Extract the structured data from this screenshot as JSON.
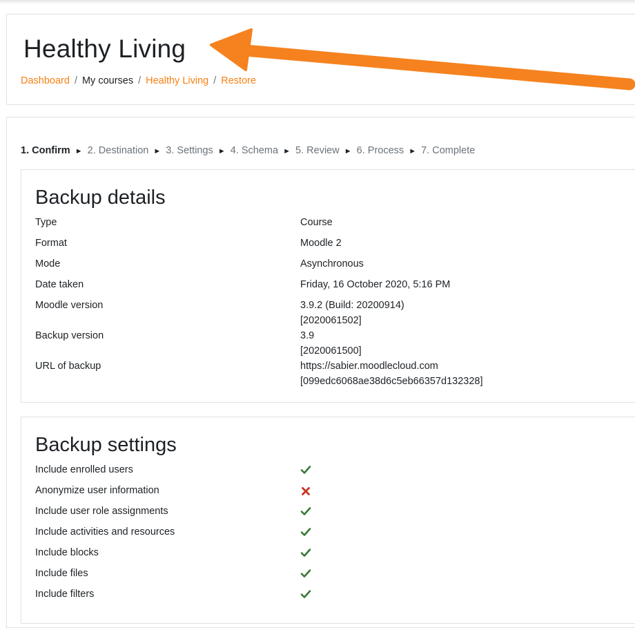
{
  "header": {
    "title": "Healthy Living",
    "breadcrumb": [
      {
        "label": "Dashboard",
        "link": true
      },
      {
        "label": "My courses",
        "link": false
      },
      {
        "label": "Healthy Living",
        "link": true
      },
      {
        "label": "Restore",
        "link": true
      }
    ],
    "separator": "/"
  },
  "stepper": {
    "steps": [
      "1. Confirm",
      "2. Destination",
      "3. Settings",
      "4. Schema",
      "5. Review",
      "6. Process",
      "7. Complete"
    ],
    "current": 0,
    "arrow_glyph": "►"
  },
  "backup_details": {
    "heading": "Backup details",
    "rows": [
      {
        "label": "Type",
        "value": [
          "Course"
        ]
      },
      {
        "label": "Format",
        "value": [
          "Moodle 2"
        ]
      },
      {
        "label": "Mode",
        "value": [
          "Asynchronous"
        ]
      },
      {
        "label": "Date taken",
        "value": [
          "Friday, 16 October 2020, 5:16 PM"
        ]
      },
      {
        "label": "Moodle version",
        "value": [
          "3.9.2 (Build: 20200914)",
          "[2020061502]"
        ]
      },
      {
        "label": "Backup version",
        "value": [
          "3.9",
          "[2020061500]"
        ]
      },
      {
        "label": "URL of backup",
        "value": [
          "https://sabier.moodlecloud.com",
          "[099edc6068ae38d6c5eb66357d132328]"
        ]
      }
    ]
  },
  "backup_settings": {
    "heading": "Backup settings",
    "rows": [
      {
        "label": "Include enrolled users",
        "status": "check-icon"
      },
      {
        "label": "Anonymize user information",
        "status": "cross-icon"
      },
      {
        "label": "Include user role assignments",
        "status": "check-icon"
      },
      {
        "label": "Include activities and resources",
        "status": "check-icon"
      },
      {
        "label": "Include blocks",
        "status": "check-icon"
      },
      {
        "label": "Include files",
        "status": "check-icon"
      },
      {
        "label": "Include filters",
        "status": "check-icon"
      }
    ]
  },
  "colors": {
    "accent": "#f98012",
    "check": "#357a32",
    "cross": "#ca3120",
    "annotation_arrow": "#f5821f"
  }
}
